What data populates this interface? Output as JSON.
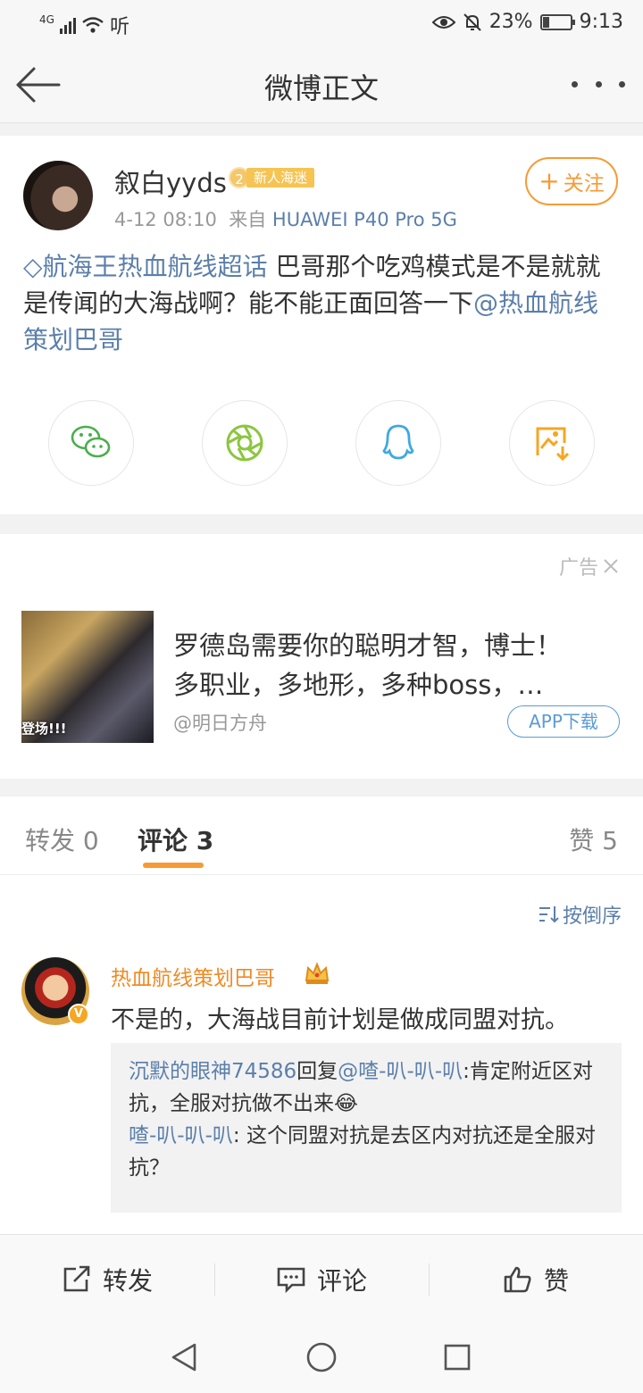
{
  "status_bar": {
    "network": "4G",
    "hd": "听",
    "battery_percent": "23%",
    "battery_level": 0.23,
    "time": "9:13"
  },
  "navbar": {
    "title": "微博正文",
    "back_icon": "back-arrow-icon",
    "more_icon": "more-dots-icon"
  },
  "post": {
    "author": "叙白yyds",
    "level": "2",
    "badge_text": "新人海迷",
    "time": "4-12 08:10",
    "source_prefix": "来自",
    "device": "HUAWEI P40 Pro 5G",
    "follow_label": "关注",
    "topic": "航海王热血航线超话",
    "body": " 巴哥那个吃鸡模式是不是就就是传闻的大海战啊？能不能正面回答一下",
    "mention": "@热血航线策划巴哥",
    "share_icons": [
      "wechat-icon",
      "moments-icon",
      "qq-icon",
      "save-image-icon"
    ]
  },
  "ad": {
    "tag": "广告",
    "line1": "罗德岛需要你的聪明才智，博士！",
    "line2": "多职业，多地形，多种boss，…",
    "image_text": "登场!!!",
    "account": "@明日方舟",
    "download_label": "APP下载"
  },
  "tabs": {
    "repost": "转发 0",
    "comment": "评论 3",
    "like": "赞 5"
  },
  "comments": {
    "sort_label": "按倒序",
    "first": {
      "name": "热血航线策划巴哥",
      "text": "不是的，大海战目前计划是做成同盟对抗。",
      "verified": "V",
      "replies": [
        {
          "user": "沉默的眼神74586",
          "reply_word": "回复",
          "target": "@喳-叭-叭-叭",
          "text": ":肯定附近区对抗，全服对抗做不出来😂"
        },
        {
          "user": "喳-叭-叭-叭",
          "text": ": 这个同盟对抗是去区内对抗还是全服对抗？"
        }
      ]
    }
  },
  "action_bar": {
    "repost": "转发",
    "comment": "评论",
    "like": "赞"
  },
  "colors": {
    "accent_orange": "#f79a35",
    "link_blue": "#5b7fab"
  }
}
